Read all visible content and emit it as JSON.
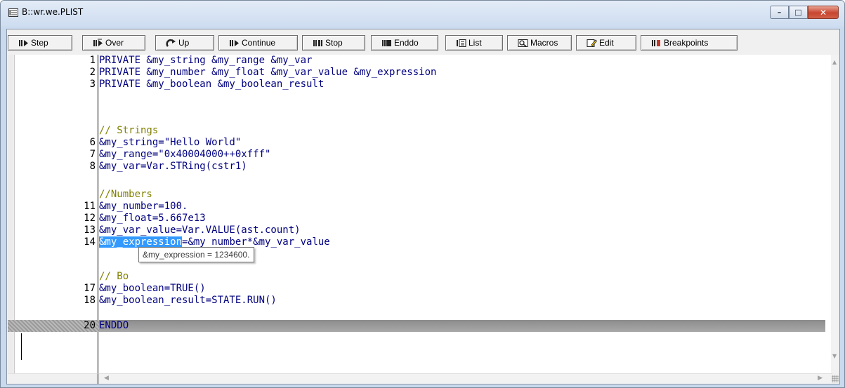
{
  "window": {
    "title": "B::wr.we.PLIST",
    "controls": {
      "minimize": "–",
      "maximize": "□",
      "close": "✕"
    }
  },
  "toolbar": {
    "buttons": [
      {
        "label": "Step",
        "icon": "step-icon"
      },
      {
        "label": "Over",
        "icon": "step-over-icon"
      },
      {
        "label": "Up",
        "icon": "step-up-icon"
      },
      {
        "label": "Continue",
        "icon": "continue-icon"
      },
      {
        "label": "Stop",
        "icon": "stop-icon"
      },
      {
        "label": "Enddo",
        "icon": "enddo-icon"
      },
      {
        "label": "List",
        "icon": "list-icon"
      },
      {
        "label": "Macros",
        "icon": "macros-icon"
      },
      {
        "label": "Edit",
        "icon": "edit-icon"
      },
      {
        "label": "Breakpoints",
        "icon": "breakpoints-icon"
      }
    ]
  },
  "code": {
    "lines": [
      {
        "num": "1",
        "text": "PRIVATE &my_string &my_range &my_var"
      },
      {
        "num": "2",
        "text": "PRIVATE &my_number &my_float &my_var_value &my_expression"
      },
      {
        "num": "3",
        "text": "PRIVATE &my_boolean &my_boolean_result"
      },
      {
        "num": "",
        "text": "// Strings"
      },
      {
        "num": "6",
        "text": "&my_string=\"Hello World\""
      },
      {
        "num": "7",
        "text": "&my_range=\"0x40004000++0xfff\""
      },
      {
        "num": "8",
        "text": "&my_var=Var.STRing(cstr1)"
      },
      {
        "num": "",
        "text": "//Numbers"
      },
      {
        "num": "11",
        "text": "&my_number=100."
      },
      {
        "num": "12",
        "text": "&my_float=5.667e13"
      },
      {
        "num": "13",
        "text": "&my_var_value=Var.VALUE(ast.count)"
      },
      {
        "num": "14",
        "selected": "&my_expression",
        "rest": "=&my_number*&my_var_value"
      },
      {
        "num": "",
        "text": "// Bo"
      },
      {
        "num": "17",
        "text": "&my_boolean=TRUE()"
      },
      {
        "num": "18",
        "text": "&my_boolean_result=STATE.RUN()"
      },
      {
        "num": "20",
        "text": "ENDDO"
      }
    ],
    "tooltip": "&my_expression = 1234600."
  },
  "colors": {
    "keyword": "#000080",
    "comment": "#808000",
    "selection": "#3399ff"
  }
}
